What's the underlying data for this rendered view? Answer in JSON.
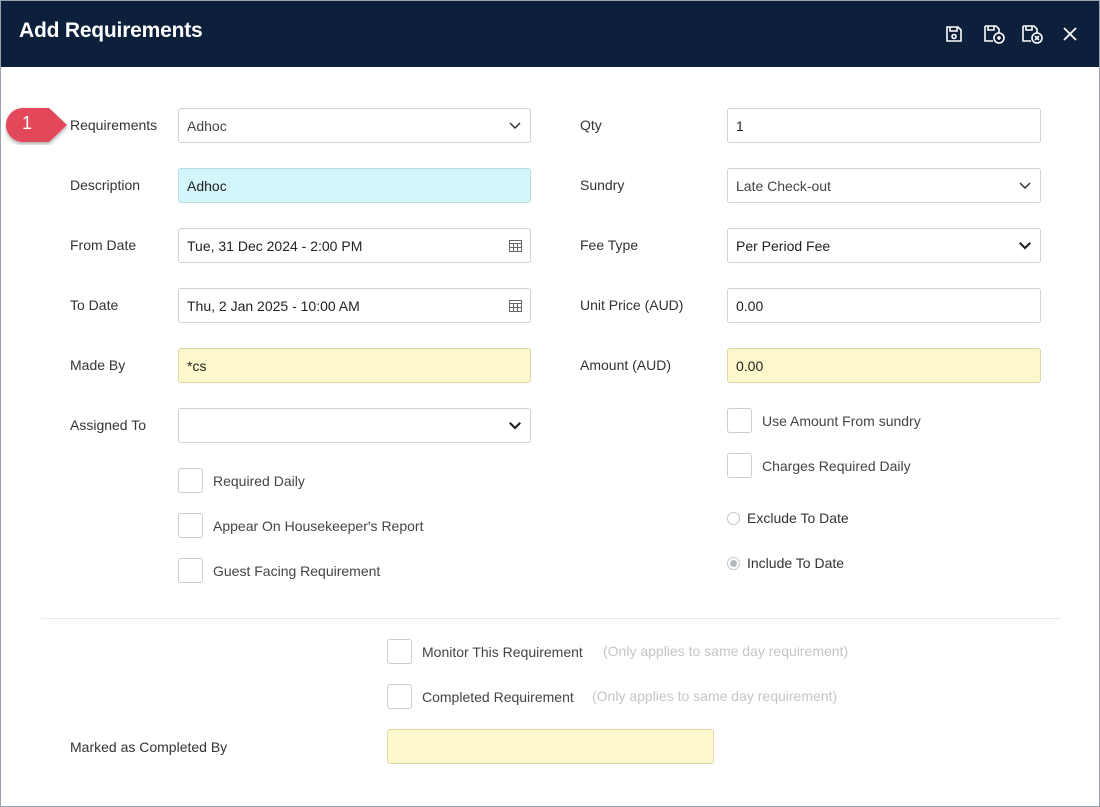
{
  "window": {
    "title": "Add Requirements"
  },
  "toolbar": [
    {
      "name": "save-icon"
    },
    {
      "name": "save-and-copy-icon"
    },
    {
      "name": "save-and-close-icon"
    },
    {
      "name": "close-icon"
    }
  ],
  "annotation": {
    "step": "1",
    "color": "#e2475a"
  },
  "left": {
    "requirements": {
      "label": "Requirements",
      "value": "Adhoc"
    },
    "description": {
      "label": "Description",
      "value": "Adhoc"
    },
    "from_date": {
      "label": "From Date",
      "value": "Tue, 31 Dec 2024 - 2:00 PM"
    },
    "to_date": {
      "label": "To Date",
      "value": "Thu, 2 Jan 2025 - 10:00 AM"
    },
    "made_by": {
      "label": "Made By",
      "value": "*cs"
    },
    "assigned_to": {
      "label": "Assigned To",
      "value": ""
    },
    "checkboxes": {
      "required_daily": "Required Daily",
      "housekeeper": "Appear On Housekeeper's Report",
      "guest_facing": "Guest Facing Requirement"
    }
  },
  "right": {
    "qty": {
      "label": "Qty",
      "value": "1"
    },
    "sundry": {
      "label": "Sundry",
      "value": "Late Check-out"
    },
    "fee_type": {
      "label": "Fee Type",
      "value": "Per Period Fee"
    },
    "unit_price": {
      "label": "Unit Price (AUD)",
      "value": "0.00"
    },
    "amount": {
      "label": "Amount (AUD)",
      "value": "0.00"
    },
    "checkboxes": {
      "use_amount": "Use Amount From sundry",
      "charges_daily": "Charges Required Daily"
    },
    "radios": {
      "exclude": "Exclude To Date",
      "include": "Include To Date"
    }
  },
  "bottom": {
    "monitor": {
      "label": "Monitor This Requirement",
      "hint": "(Only applies to same day requirement)"
    },
    "completed": {
      "label": "Completed Requirement",
      "hint": "(Only applies to same day requirement)"
    },
    "marked_by": {
      "label": "Marked as Completed By",
      "value": ""
    }
  },
  "colors": {
    "titlebar": "#0c1f3b",
    "cyan_field": "#d2f6fa",
    "yellow_field": "#fdf7cc"
  }
}
